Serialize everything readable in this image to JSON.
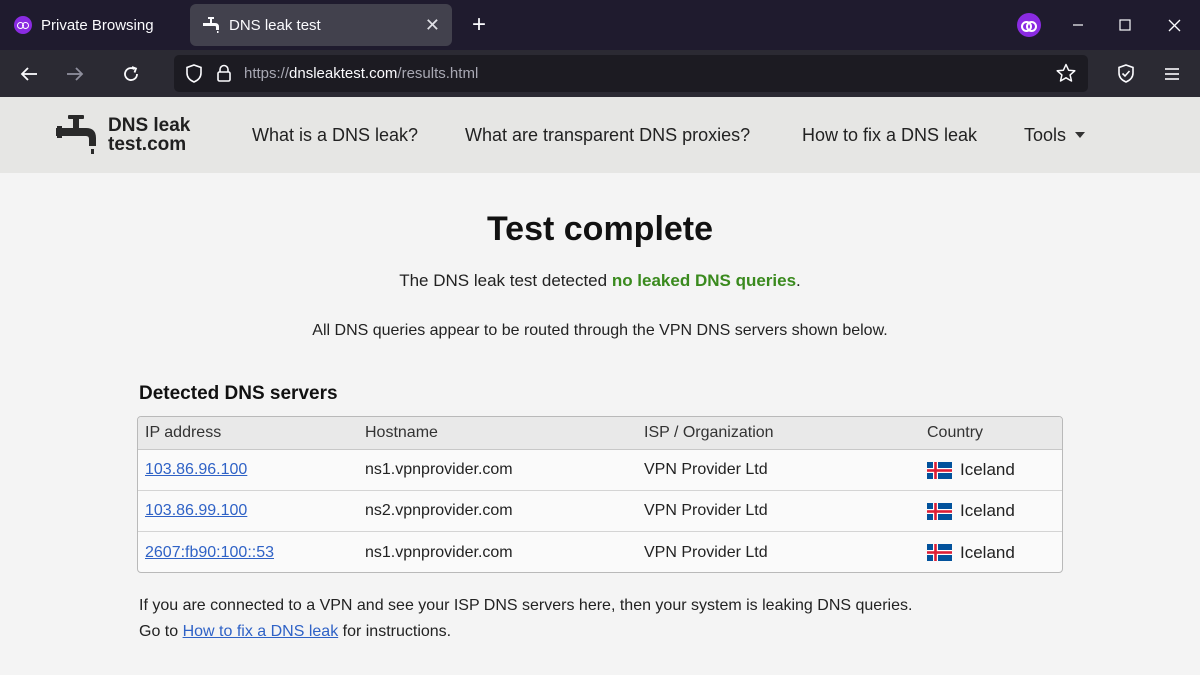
{
  "browser": {
    "mode_label": "Private Browsing",
    "tab_title": "DNS leak test",
    "tab_close_glyph": "✕",
    "new_tab_glyph": "+",
    "url_scheme": "https://",
    "url_domain": "dnsleaktest.com",
    "url_path": "/results.html"
  },
  "site": {
    "logo_line1": "DNS leak",
    "logo_line2": "test.com",
    "nav": [
      {
        "label": "What is a DNS leak?"
      },
      {
        "label": "What are transparent DNS proxies?"
      },
      {
        "label": "How to fix a DNS leak"
      },
      {
        "label": "Tools"
      }
    ]
  },
  "main": {
    "title": "Test complete",
    "result_prefix": "The DNS leak test detected ",
    "result_highlight": "no leaked DNS queries",
    "result_suffix": ".",
    "subtext": "All DNS queries appear to be routed through the VPN DNS servers shown below.",
    "section_title": "Detected DNS servers",
    "table": {
      "headers": [
        "IP address",
        "Hostname",
        "ISP / Organization",
        "Country"
      ],
      "rows": [
        {
          "ip": "103.86.96.100",
          "hostname": "ns1.vpnprovider.com",
          "isp": "VPN Provider Ltd",
          "country": "Iceland"
        },
        {
          "ip": "103.86.99.100",
          "hostname": "ns2.vpnprovider.com",
          "isp": "VPN Provider Ltd",
          "country": "Iceland"
        },
        {
          "ip": "2607:fb90:100::53",
          "hostname": "ns1.vpnprovider.com",
          "isp": "VPN Provider Ltd",
          "country": "Iceland"
        }
      ]
    },
    "footer_line1": "If you are connected to a VPN and see your ISP DNS servers here, then your system is leaking DNS queries.",
    "footer_prefix": "Go to ",
    "footer_link": "How to fix a DNS leak",
    "footer_suffix": " for instructions."
  },
  "colors": {
    "tabbar_bg": "#1f1b2e",
    "navbar_bg": "#2b2a33",
    "private_purple": "#8a2be2",
    "success_green": "#3a8a1e",
    "link_blue": "#2f62c6"
  }
}
